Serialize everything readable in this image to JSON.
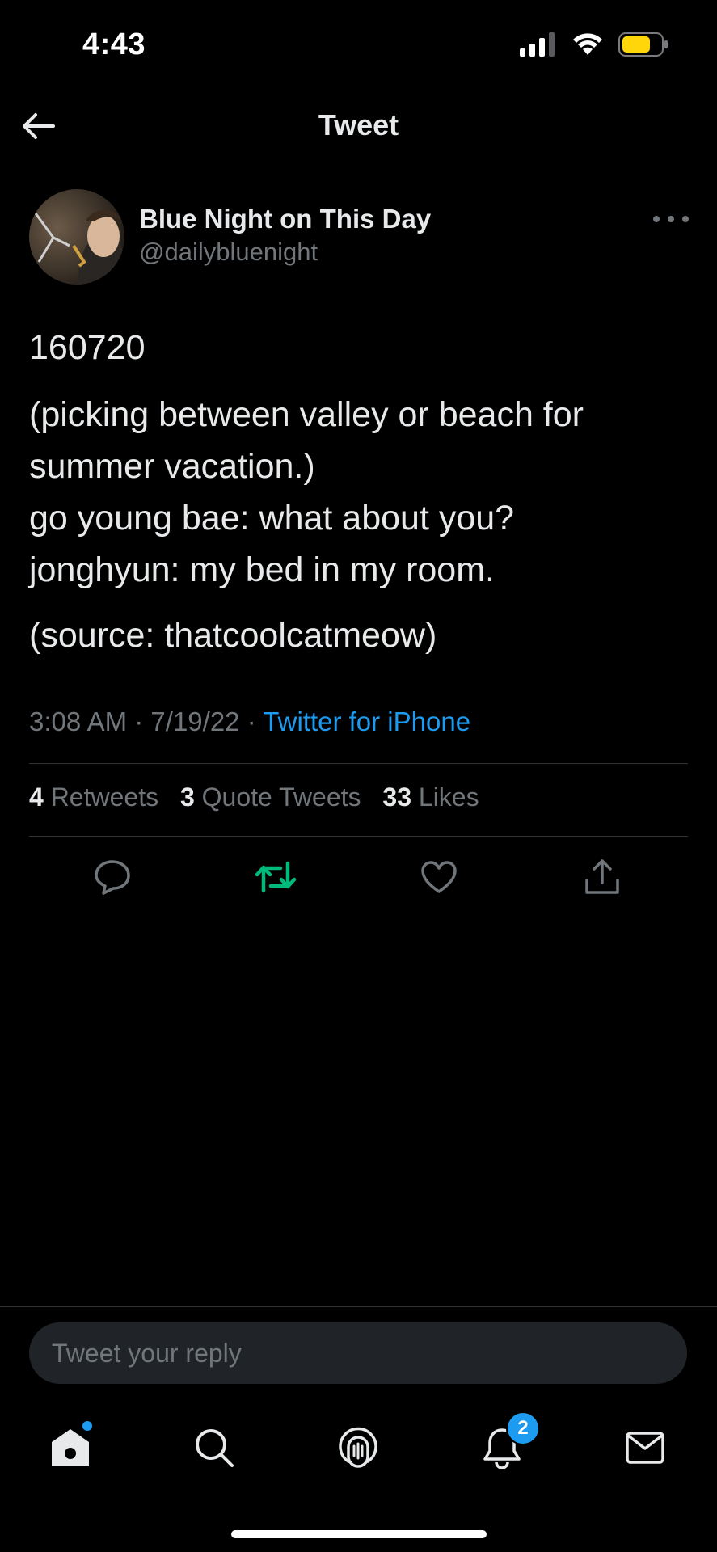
{
  "status_bar": {
    "time": "4:43",
    "battery_color": "#ffd60a"
  },
  "header": {
    "title": "Tweet"
  },
  "tweet": {
    "author_name": "Blue Night on This Day",
    "author_handle": "@dailybluenight",
    "lines": [
      "160720",
      "(picking between valley or beach for",
      "summer vacation.)",
      "go young bae: what about you?",
      "jonghyun: my bed in my room.",
      "(source: thatcoolcatmeow)"
    ],
    "time": "3:08 AM",
    "date": "7/19/22",
    "separator": "·",
    "source": "Twitter for iPhone",
    "stats": {
      "retweets_count": "4",
      "retweets_label": "Retweets",
      "quotes_count": "3",
      "quotes_label": "Quote Tweets",
      "likes_count": "33",
      "likes_label": "Likes"
    },
    "actions": [
      "reply-icon",
      "retweet-icon",
      "like-icon",
      "share-icon"
    ]
  },
  "composer": {
    "placeholder": "Tweet your reply"
  },
  "bottom_nav": {
    "items": [
      "home-icon",
      "search-icon",
      "spaces-icon",
      "notifications-icon",
      "messages-icon"
    ],
    "notifications_badge": "2"
  },
  "colors": {
    "accent": "#1d9bf0",
    "retweet_active": "#00ba7c",
    "muted": "#71767b",
    "background": "#000000"
  }
}
